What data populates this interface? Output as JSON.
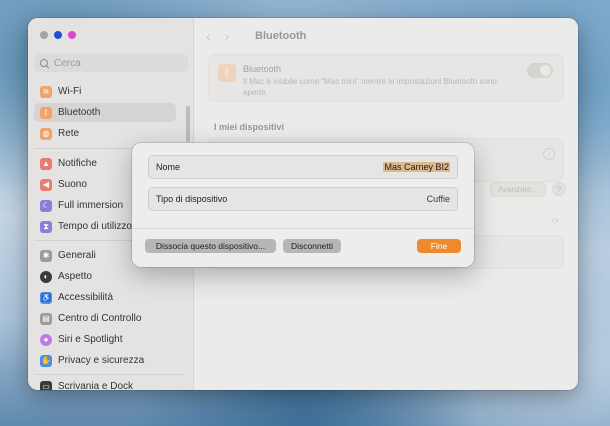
{
  "window": {
    "title": "Bluetooth",
    "traffic_lights": [
      "#a3a3a3",
      "#1e4fd6",
      "#d94ad0"
    ]
  },
  "sidebar": {
    "search_placeholder": "Cerca",
    "items": [
      {
        "label": "Wi-Fi",
        "icon": "wifi-icon",
        "color": "#f0a36a"
      },
      {
        "label": "Bluetooth",
        "icon": "bluetooth-icon",
        "color": "#f0a36a",
        "active": true
      },
      {
        "label": "Rete",
        "icon": "globe-icon",
        "color": "#f0a36a"
      },
      {
        "label": "Notifiche",
        "icon": "bell-icon",
        "color": "#e87b72"
      },
      {
        "label": "Suono",
        "icon": "speaker-icon",
        "color": "#e87b72"
      },
      {
        "label": "Full immersion",
        "icon": "moon-icon",
        "color": "#8a7fd6"
      },
      {
        "label": "Tempo di utilizzo",
        "icon": "hourglass-icon",
        "color": "#8a7fd6"
      },
      {
        "label": "Generali",
        "icon": "gear-icon",
        "color": "#9c9c9c"
      },
      {
        "label": "Aspetto",
        "icon": "appearance-icon",
        "color": "#3a3a3a"
      },
      {
        "label": "Accessibilità",
        "icon": "accessibility-icon",
        "color": "#4d8ee6"
      },
      {
        "label": "Centro di Controllo",
        "icon": "control-center-icon",
        "color": "#9c9c9c"
      },
      {
        "label": "Siri e Spotlight",
        "icon": "siri-icon",
        "color": "#c07be0"
      },
      {
        "label": "Privacy e sicurezza",
        "icon": "hand-icon",
        "color": "#4d8ee6"
      },
      {
        "label": "Scrivania e Dock",
        "icon": "dock-icon",
        "color": "#3a3a3a"
      }
    ]
  },
  "content": {
    "bluetooth_card": {
      "title": "Bluetooth",
      "description": "Il Mac è visibile come \"Mac mini\" mentre le impostazioni Bluetooth sono aperte.",
      "toggle_on": true
    },
    "section_title": "I miei dispositivi",
    "advanced_button": "Avanzate...",
    "help_button": "?",
    "info_button": "i"
  },
  "sheet": {
    "name_label": "Nome",
    "name_value": "Mas Carney BI2",
    "type_label": "Tipo di dispositivo",
    "type_value": "Cuffie",
    "forget_button": "Dissocia questo dispositivo...",
    "disconnect_button": "Disconnetti",
    "done_button": "Fine",
    "accent_color": "#ec8a2c"
  }
}
